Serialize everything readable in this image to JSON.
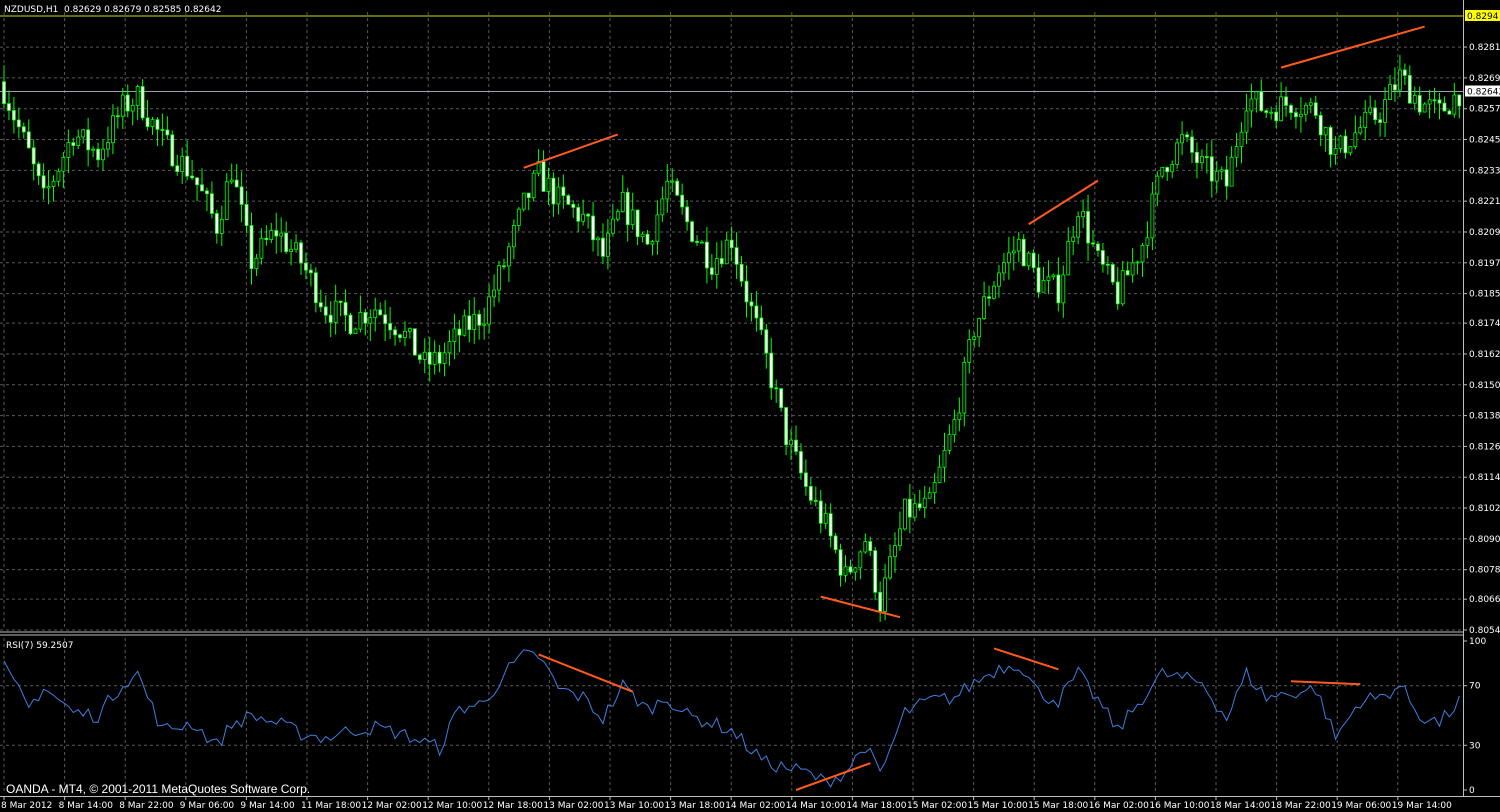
{
  "header": {
    "symbol_label": "NZDUSD,H1",
    "ohlc": "0.82629 0.82679 0.82585 0.82642"
  },
  "indicator": {
    "label": "RSI(7) 59.2507",
    "color": "#3f7fe0"
  },
  "copyright": "OANDA - MT4, © 2001-2011 MetaQuotes Software Corp.",
  "colors": {
    "background": "#000000",
    "grid": "#5a5a5a",
    "bull_candle": "#00ff00",
    "bear_candle": "#ffffff",
    "divergence_lines": "#ff5a1e",
    "bid_line": "#8fa3b4",
    "ask_line": "#d8d800",
    "ask_label_bg": "#ffff00",
    "bid_label_bg": "#ffffff"
  },
  "price_axis": {
    "ticks": [
      "0.82815",
      "0.82695",
      "0.82575",
      "0.82455",
      "0.82335",
      "0.82215",
      "0.82095",
      "0.81975",
      "0.81855",
      "0.81740",
      "0.81620",
      "0.81500",
      "0.81380",
      "0.81260",
      "0.81140",
      "0.81020",
      "0.80900",
      "0.80780",
      "0.80665",
      "0.80545"
    ],
    "current_bid": "0.82642",
    "ask_marker": "0.8294"
  },
  "rsi_axis": {
    "ticks": [
      "100",
      "70",
      "30",
      "0"
    ]
  },
  "time_axis": {
    "ticks": [
      "8 Mar 2012",
      "8 Mar 14:00",
      "8 Mar 22:00",
      "9 Mar 06:00",
      "9 Mar 14:00",
      "11 Mar 18:00",
      "12 Mar 02:00",
      "12 Mar 10:00",
      "12 Mar 18:00",
      "13 Mar 02:00",
      "13 Mar 10:00",
      "13 Mar 18:00",
      "14 Mar 02:00",
      "14 Mar 10:00",
      "14 Mar 18:00",
      "15 Mar 02:00",
      "15 Mar 10:00",
      "15 Mar 18:00",
      "16 Mar 02:00",
      "16 Mar 10:00",
      "18 Mar 14:00",
      "18 Mar 22:00",
      "19 Mar 06:00",
      "19 Mar 14:00"
    ]
  },
  "chart_data": [
    {
      "type": "candlestick",
      "symbol": "NZDUSD",
      "timeframe": "H1",
      "ylim": [
        0.80545,
        0.8294
      ],
      "anchors": [
        {
          "i": 0,
          "p": 0.8265
        },
        {
          "i": 5,
          "p": 0.824
        },
        {
          "i": 8,
          "p": 0.8222
        },
        {
          "i": 14,
          "p": 0.8248
        },
        {
          "i": 19,
          "p": 0.824
        },
        {
          "i": 24,
          "p": 0.8258
        },
        {
          "i": 27,
          "p": 0.8262
        },
        {
          "i": 32,
          "p": 0.8245
        },
        {
          "i": 38,
          "p": 0.8232
        },
        {
          "i": 43,
          "p": 0.8212
        },
        {
          "i": 46,
          "p": 0.8234
        },
        {
          "i": 50,
          "p": 0.8198
        },
        {
          "i": 55,
          "p": 0.821
        },
        {
          "i": 60,
          "p": 0.8198
        },
        {
          "i": 65,
          "p": 0.818
        },
        {
          "i": 70,
          "p": 0.8175
        },
        {
          "i": 75,
          "p": 0.818
        },
        {
          "i": 80,
          "p": 0.8172
        },
        {
          "i": 85,
          "p": 0.8158
        },
        {
          "i": 88,
          "p": 0.816
        },
        {
          "i": 92,
          "p": 0.817
        },
        {
          "i": 97,
          "p": 0.8178
        },
        {
          "i": 101,
          "p": 0.8197
        },
        {
          "i": 105,
          "p": 0.822
        },
        {
          "i": 108,
          "p": 0.8232
        },
        {
          "i": 112,
          "p": 0.8222
        },
        {
          "i": 117,
          "p": 0.8215
        },
        {
          "i": 121,
          "p": 0.82
        },
        {
          "i": 125,
          "p": 0.822
        },
        {
          "i": 130,
          "p": 0.8205
        },
        {
          "i": 134,
          "p": 0.8228
        },
        {
          "i": 138,
          "p": 0.8213
        },
        {
          "i": 143,
          "p": 0.8198
        },
        {
          "i": 147,
          "p": 0.8207
        },
        {
          "i": 150,
          "p": 0.8185
        },
        {
          "i": 154,
          "p": 0.816
        },
        {
          "i": 158,
          "p": 0.813
        },
        {
          "i": 162,
          "p": 0.811
        },
        {
          "i": 166,
          "p": 0.8095
        },
        {
          "i": 170,
          "p": 0.8075
        },
        {
          "i": 174,
          "p": 0.809
        },
        {
          "i": 177,
          "p": 0.8065
        },
        {
          "i": 182,
          "p": 0.81
        },
        {
          "i": 187,
          "p": 0.8103
        },
        {
          "i": 192,
          "p": 0.8135
        },
        {
          "i": 196,
          "p": 0.8172
        },
        {
          "i": 201,
          "p": 0.8195
        },
        {
          "i": 205,
          "p": 0.8205
        },
        {
          "i": 209,
          "p": 0.819
        },
        {
          "i": 213,
          "p": 0.8187
        },
        {
          "i": 217,
          "p": 0.822
        },
        {
          "i": 221,
          "p": 0.8198
        },
        {
          "i": 225,
          "p": 0.8185
        },
        {
          "i": 230,
          "p": 0.8205
        },
        {
          "i": 234,
          "p": 0.8235
        },
        {
          "i": 238,
          "p": 0.8245
        },
        {
          "i": 242,
          "p": 0.8235
        },
        {
          "i": 247,
          "p": 0.8228
        },
        {
          "i": 251,
          "p": 0.8262
        },
        {
          "i": 255,
          "p": 0.8257
        },
        {
          "i": 260,
          "p": 0.826
        },
        {
          "i": 265,
          "p": 0.8257
        },
        {
          "i": 269,
          "p": 0.824
        },
        {
          "i": 274,
          "p": 0.825
        },
        {
          "i": 278,
          "p": 0.8256
        },
        {
          "i": 282,
          "p": 0.827
        },
        {
          "i": 286,
          "p": 0.826
        },
        {
          "i": 290,
          "p": 0.8256
        },
        {
          "i": 294,
          "p": 0.8264
        }
      ],
      "divergence_lines": [
        {
          "from": {
            "i": 105,
            "p": 0.82345
          },
          "to": {
            "i": 124,
            "p": 0.82475
          }
        },
        {
          "from": {
            "i": 165,
            "p": 0.80675
          },
          "to": {
            "i": 181,
            "p": 0.80595
          }
        },
        {
          "from": {
            "i": 207,
            "p": 0.82125
          },
          "to": {
            "i": 221,
            "p": 0.82295
          }
        },
        {
          "from": {
            "i": 258,
            "p": 0.82735
          },
          "to": {
            "i": 287,
            "p": 0.82895
          }
        }
      ],
      "current_bid": 0.82642,
      "ask_marker": 0.8294
    },
    {
      "type": "line",
      "name": "RSI(7)",
      "last_value": 59.2507,
      "ylim": [
        0,
        100
      ],
      "levels": [
        70,
        30
      ],
      "anchors": [
        {
          "i": 0,
          "v": 82
        },
        {
          "i": 5,
          "v": 55
        },
        {
          "i": 8,
          "v": 69
        },
        {
          "i": 14,
          "v": 52
        },
        {
          "i": 19,
          "v": 50
        },
        {
          "i": 24,
          "v": 72
        },
        {
          "i": 27,
          "v": 78
        },
        {
          "i": 32,
          "v": 40
        },
        {
          "i": 38,
          "v": 45
        },
        {
          "i": 43,
          "v": 30
        },
        {
          "i": 46,
          "v": 44
        },
        {
          "i": 50,
          "v": 50
        },
        {
          "i": 55,
          "v": 45
        },
        {
          "i": 60,
          "v": 38
        },
        {
          "i": 65,
          "v": 35
        },
        {
          "i": 70,
          "v": 40
        },
        {
          "i": 75,
          "v": 42
        },
        {
          "i": 80,
          "v": 38
        },
        {
          "i": 85,
          "v": 32
        },
        {
          "i": 88,
          "v": 28
        },
        {
          "i": 92,
          "v": 55
        },
        {
          "i": 97,
          "v": 58
        },
        {
          "i": 101,
          "v": 78
        },
        {
          "i": 105,
          "v": 90
        },
        {
          "i": 108,
          "v": 90
        },
        {
          "i": 112,
          "v": 68
        },
        {
          "i": 117,
          "v": 62
        },
        {
          "i": 121,
          "v": 48
        },
        {
          "i": 125,
          "v": 70
        },
        {
          "i": 130,
          "v": 54
        },
        {
          "i": 134,
          "v": 62
        },
        {
          "i": 138,
          "v": 50
        },
        {
          "i": 143,
          "v": 45
        },
        {
          "i": 147,
          "v": 40
        },
        {
          "i": 150,
          "v": 30
        },
        {
          "i": 154,
          "v": 18
        },
        {
          "i": 158,
          "v": 15
        },
        {
          "i": 162,
          "v": 12
        },
        {
          "i": 166,
          "v": 5
        },
        {
          "i": 170,
          "v": 12
        },
        {
          "i": 174,
          "v": 30
        },
        {
          "i": 177,
          "v": 10
        },
        {
          "i": 182,
          "v": 52
        },
        {
          "i": 187,
          "v": 60
        },
        {
          "i": 192,
          "v": 62
        },
        {
          "i": 196,
          "v": 72
        },
        {
          "i": 201,
          "v": 82
        },
        {
          "i": 205,
          "v": 85
        },
        {
          "i": 209,
          "v": 65
        },
        {
          "i": 213,
          "v": 60
        },
        {
          "i": 217,
          "v": 78
        },
        {
          "i": 221,
          "v": 60
        },
        {
          "i": 225,
          "v": 40
        },
        {
          "i": 230,
          "v": 62
        },
        {
          "i": 234,
          "v": 78
        },
        {
          "i": 238,
          "v": 75
        },
        {
          "i": 242,
          "v": 72
        },
        {
          "i": 247,
          "v": 48
        },
        {
          "i": 251,
          "v": 78
        },
        {
          "i": 255,
          "v": 62
        },
        {
          "i": 260,
          "v": 65
        },
        {
          "i": 265,
          "v": 68
        },
        {
          "i": 269,
          "v": 35
        },
        {
          "i": 274,
          "v": 60
        },
        {
          "i": 278,
          "v": 62
        },
        {
          "i": 282,
          "v": 70
        },
        {
          "i": 286,
          "v": 50
        },
        {
          "i": 290,
          "v": 45
        },
        {
          "i": 294,
          "v": 59.25
        }
      ],
      "divergence_lines": [
        {
          "from": {
            "i": 108,
            "v": 91
          },
          "to": {
            "i": 127,
            "v": 66
          }
        },
        {
          "from": {
            "i": 160,
            "v": 0
          },
          "to": {
            "i": 175,
            "v": 18
          }
        },
        {
          "from": {
            "i": 200,
            "v": 95
          },
          "to": {
            "i": 213,
            "v": 81
          }
        },
        {
          "from": {
            "i": 260,
            "v": 73
          },
          "to": {
            "i": 274,
            "v": 71
          }
        }
      ]
    }
  ]
}
